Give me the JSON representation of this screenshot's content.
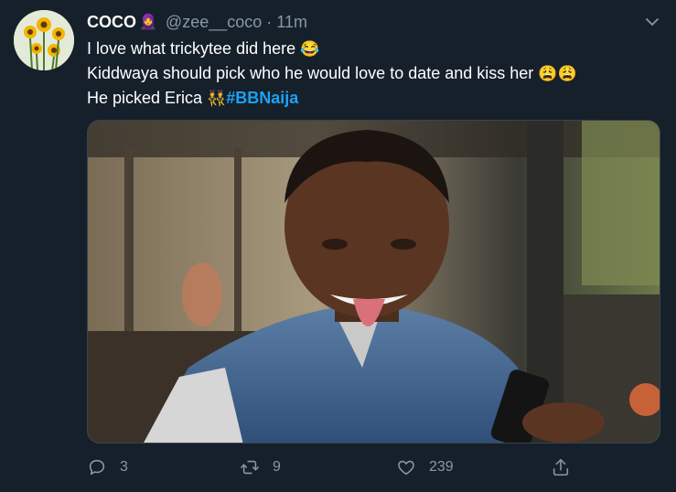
{
  "tweet": {
    "author_name": "COCO",
    "name_emoji": "🧕",
    "handle": "@zee__coco",
    "separator": "·",
    "time": "11m",
    "lines": [
      {
        "text": "I love what trickytee did here",
        "emoji": "😂"
      },
      {
        "text": "Kiddwaya should pick who he would love to date and kiss her",
        "emoji": "😩😩"
      },
      {
        "text": "He picked Erica",
        "emoji": "👯",
        "hashtag": "#BBNaija"
      }
    ]
  },
  "actions": {
    "reply_count": "3",
    "retweet_count": "9",
    "like_count": "239"
  },
  "colors": {
    "background": "#15202b",
    "secondary_text": "#8899a6",
    "link": "#1da1f2",
    "border": "#38444d"
  },
  "icons": [
    "sunflower-avatar-icon",
    "caret-down-icon",
    "reply-icon",
    "retweet-icon",
    "like-icon",
    "share-icon"
  ]
}
